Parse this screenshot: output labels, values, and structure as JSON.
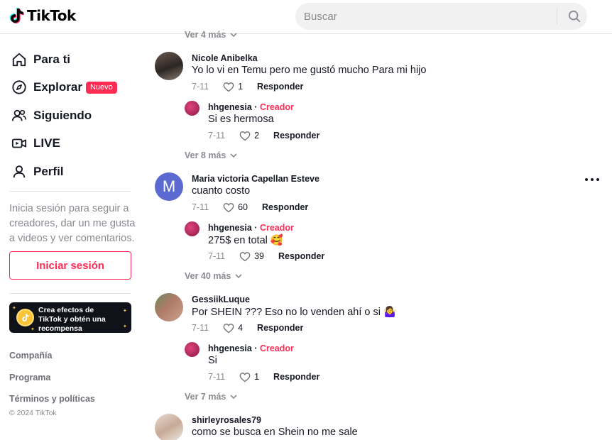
{
  "header": {
    "logo_text": "TikTok",
    "search_placeholder": "Buscar",
    "search_icon": "search-icon"
  },
  "sidebar": {
    "nav": [
      {
        "label": "Para ti",
        "icon": "home-icon"
      },
      {
        "label": "Explorar",
        "icon": "compass-icon",
        "badge": "Nuevo"
      },
      {
        "label": "Siguiendo",
        "icon": "following-icon"
      },
      {
        "label": "LIVE",
        "icon": "live-icon"
      },
      {
        "label": "Perfil",
        "icon": "profile-icon"
      }
    ],
    "login_prompt": "Inicia sesión para seguir a creadores, dar un me gusta a videos y ver comentarios.",
    "login_button": "Iniciar sesión",
    "promo": "Crea efectos de TikTok y obtén una recompensa",
    "footer_links": [
      "Compañía",
      "Programa",
      "Términos y políticas"
    ],
    "copyright": "© 2024 TikTok"
  },
  "comments": {
    "top_more": "Ver 4 más",
    "items": [
      {
        "user": "Nicole Anibelka",
        "text": "Yo lo vi en Temu pero me gustó mucho Para mi hijo",
        "date": "7-11",
        "likes": "1",
        "reply": "Responder",
        "replies": [
          {
            "user": "hhgenesia",
            "role": "Creador",
            "text": "Si es hermosa",
            "date": "7-11",
            "likes": "2",
            "reply": "Responder"
          }
        ],
        "more": "Ver 8 más"
      },
      {
        "user": "Maria victoria Capellan Esteve",
        "avatar_letter": "M",
        "text": "cuanto costo",
        "date": "7-11",
        "likes": "60",
        "reply": "Responder",
        "replies": [
          {
            "user": "hhgenesia",
            "role": "Creador",
            "text": "275$ en total 🥰",
            "date": "7-11",
            "likes": "39",
            "reply": "Responder"
          }
        ],
        "more": "Ver 40 más"
      },
      {
        "user": "GessiikLuque",
        "text": "Por SHEIN ??? Eso no lo venden ahí o si 🤷‍♀️",
        "date": "7-11",
        "likes": "4",
        "reply": "Responder",
        "replies": [
          {
            "user": "hhgenesia",
            "role": "Creador",
            "text": "Si",
            "date": "7-11",
            "likes": "1",
            "reply": "Responder"
          }
        ],
        "more": "Ver 7 más"
      },
      {
        "user": "shirleyrosales79",
        "text": "como se busca en Shein no me sale"
      }
    ]
  },
  "colors": {
    "accent": "#fe2c55",
    "text": "#161823",
    "muted": "#8a8b91",
    "avatar_m": "#5b6ad1"
  }
}
